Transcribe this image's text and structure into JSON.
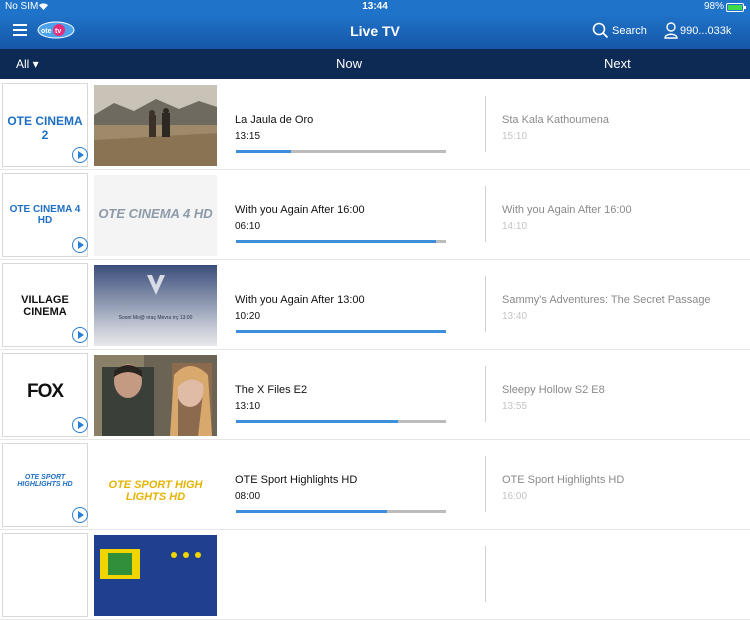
{
  "status_bar": {
    "carrier": "No SIM",
    "time": "13:44",
    "battery": "98%",
    "battery_level": 0.98
  },
  "nav": {
    "title": "Live TV",
    "search_label": "Search",
    "account_label": "990...033k",
    "logo": "ote tv"
  },
  "subheader": {
    "filter_label": "All ▾",
    "now_label": "Now",
    "next_label": "Next"
  },
  "channels": [
    {
      "logo": "OTE CINEMA 2",
      "thumb_text": "",
      "now_title": "La Jaula de Oro",
      "now_time": "13:15",
      "progress": 0.26,
      "next_title": "Sta Kala Kathoumena",
      "next_time": "15:10"
    },
    {
      "logo": "OTE CINEMA 4 HD",
      "thumb_text": "OTE CINEMA 4 HD",
      "now_title": "With you Again After 16:00",
      "now_time": "06:10",
      "progress": 0.95,
      "next_title": "With you Again After 16:00",
      "next_time": "14:10"
    },
    {
      "logo": "VILLAGE CINEMA",
      "thumb_text": "Sooni Mo@ oraç Mevra rrç 13:00",
      "now_title": "With you Again After 13:00",
      "now_time": "10:20",
      "progress": 1.0,
      "next_title": "Sammy's Adventures: The Secret Passage",
      "next_time": "13:40"
    },
    {
      "logo": "FOX",
      "thumb_text": "",
      "now_title": "The X Files E2",
      "now_time": "13:10",
      "progress": 0.77,
      "next_title": "Sleepy Hollow S2 E8",
      "next_time": "13:55"
    },
    {
      "logo": "OTE SPORT HIGHLIGHTS HD",
      "thumb_text": "OTE SPORT HIGH LIGHTS HD",
      "now_title": "OTE Sport Highlights HD",
      "now_time": "08:00",
      "progress": 0.72,
      "next_title": "OTE Sport Highlights HD",
      "next_time": "16:00"
    },
    {
      "logo": "",
      "thumb_text": "",
      "now_title": "",
      "now_time": "",
      "progress": 0,
      "next_title": "",
      "next_time": ""
    }
  ]
}
